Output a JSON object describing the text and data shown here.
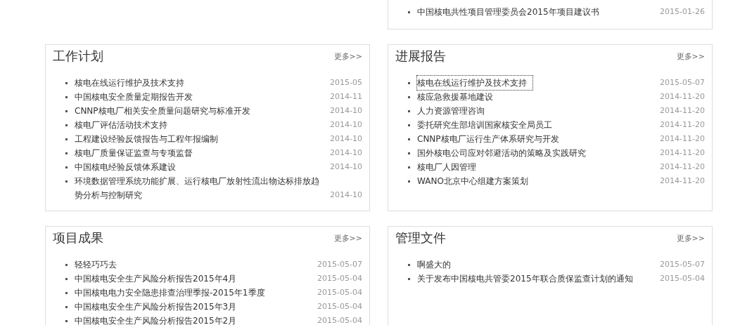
{
  "top_panel": {
    "items": [
      {
        "title": "中国核电共性项目管理委员会2015年项目建议书",
        "date": "2015-01-26",
        "focused": false
      }
    ]
  },
  "panels": [
    {
      "title": "工作计划",
      "more": "更多>>",
      "items": [
        {
          "title": "核电在线运行维护及技术支持",
          "date": "2015-05",
          "focused": false
        },
        {
          "title": "中国核电安全质量定期报告开发",
          "date": "2014-11",
          "focused": false
        },
        {
          "title": "CNNP核电厂相关安全质量问题研究与标准开发",
          "date": "2014-10",
          "focused": false
        },
        {
          "title": "核电厂评估活动技术支持",
          "date": "2014-10",
          "focused": false
        },
        {
          "title": "工程建设经验反馈报告与工程年报编制",
          "date": "2014-10",
          "focused": false
        },
        {
          "title": "核电厂质量保证监查与专项监督",
          "date": "2014-10",
          "focused": false
        },
        {
          "title": "中国核电经验反馈体系建设",
          "date": "2014-10",
          "focused": false
        },
        {
          "title": "环境数据管理系统功能扩展、运行核电厂放射性流出物达标排放趋势分析与控制研究",
          "date": "2014-10",
          "focused": false
        }
      ]
    },
    {
      "title": "进展报告",
      "more": "更多>>",
      "items": [
        {
          "title": "核电在线运行维护及技术支持",
          "date": "2015-05-07",
          "focused": true
        },
        {
          "title": "核应急救援基地建设",
          "date": "2014-11-20",
          "focused": false
        },
        {
          "title": "人力资源管理咨询",
          "date": "2014-11-20",
          "focused": false
        },
        {
          "title": "委托研究生部培训国家核安全局员工",
          "date": "2014-11-20",
          "focused": false
        },
        {
          "title": "CNNP核电厂运行生产体系研究与开发",
          "date": "2014-11-20",
          "focused": false
        },
        {
          "title": "国外核电公司应对邻避活动的策略及实践研究",
          "date": "2014-11-20",
          "focused": false
        },
        {
          "title": "核电厂人因管理",
          "date": "2014-11-20",
          "focused": false
        },
        {
          "title": "WANO北京中心组建方案策划",
          "date": "2014-11-20",
          "focused": false
        }
      ]
    },
    {
      "title": "项目成果",
      "more": "更多>>",
      "items": [
        {
          "title": "轻轻巧巧去",
          "date": "2015-05-07",
          "focused": false
        },
        {
          "title": "中国核电安全生产风险分析报告2015年4月",
          "date": "2015-05-04",
          "focused": false
        },
        {
          "title": "中国核电电力安全隐患排查治理季报-2015年1季度",
          "date": "2015-05-04",
          "focused": false
        },
        {
          "title": "中国核电安全生产风险分析报告2015年3月",
          "date": "2015-05-04",
          "focused": false
        },
        {
          "title": "中国核电安全生产风险分析报告2015年2月",
          "date": "2015-05-04",
          "focused": false
        }
      ]
    },
    {
      "title": "管理文件",
      "more": "更多>>",
      "items": [
        {
          "title": "啊盛大的",
          "date": "2015-05-07",
          "focused": false
        },
        {
          "title": "关于发布中国核电共管委2015年联合质保监查计划的通知",
          "date": "2015-05-04",
          "focused": false
        }
      ]
    }
  ]
}
